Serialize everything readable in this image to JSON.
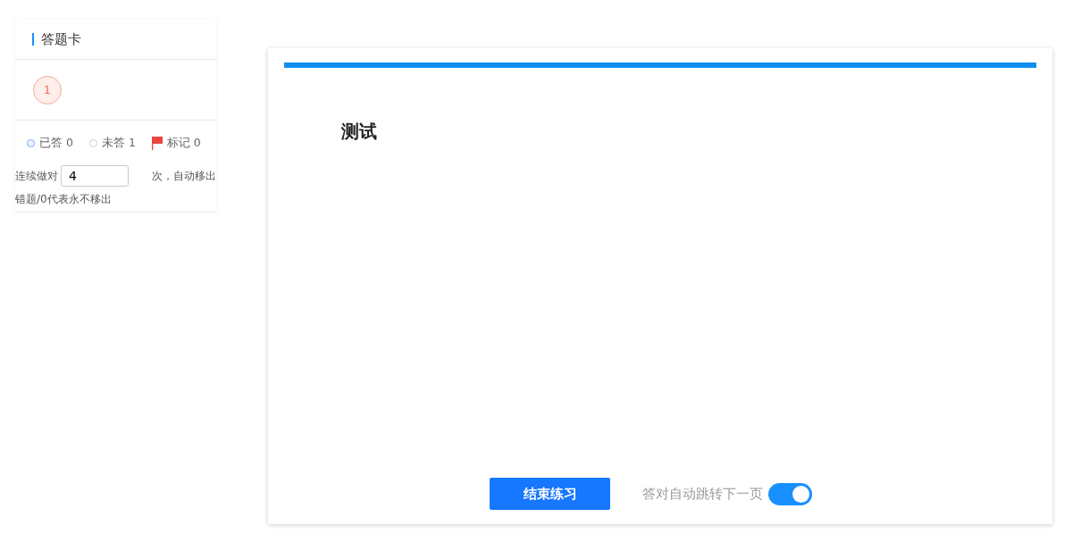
{
  "answer_card": {
    "title": "答题卡",
    "questions": [
      {
        "number": "1",
        "selected": true
      }
    ],
    "legend": [
      {
        "kind": "answered",
        "label": "已答",
        "count": "0"
      },
      {
        "kind": "unanswered",
        "label": "未答",
        "count": "1"
      },
      {
        "kind": "flagged",
        "label": "标记",
        "count": "0"
      }
    ],
    "auto_remove": {
      "prefix": "连续做对",
      "value": "4",
      "suffix": "次，自动移出",
      "note": "错题/0代表永不移出"
    }
  },
  "question": {
    "title": "测试"
  },
  "footer": {
    "finish_button": "结束练习",
    "auto_next": {
      "label": "答对自动跳转下一页",
      "on": true
    }
  }
}
